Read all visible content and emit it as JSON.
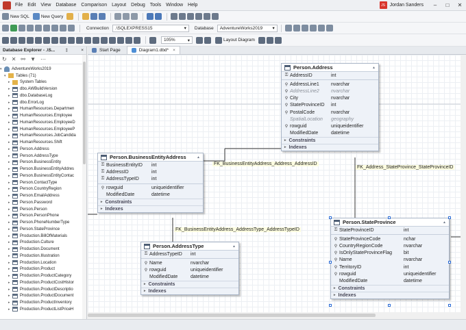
{
  "menu": {
    "items": [
      "File",
      "Edit",
      "View",
      "Database",
      "Comparison",
      "Layout",
      "Debug",
      "Tools",
      "Window",
      "Help"
    ],
    "user": "Jordan Sanders",
    "avatar": "JS"
  },
  "toolbar1": {
    "new_sql": "New SQL",
    "new_query": "New Query"
  },
  "toolbar2": {
    "connection_label": "Connection",
    "connection_value": ".\\SQLEXPRESS15",
    "database_label": "Database",
    "database_value": "AdventureWorks2019"
  },
  "toolbar3": {
    "zoom": "105%",
    "layout_diagram": "Layout Diagram"
  },
  "explorer": {
    "title": "Database Explorer - .\\S...",
    "pin": "‡",
    "close": "×",
    "db": "AdventureWorks2019",
    "tables": "Tables (71)",
    "items": [
      "System Tables",
      "dbo.AWBuildVersion",
      "dbo.DatabaseLog",
      "dbo.ErrorLog",
      "HumanResources.Departmen",
      "HumanResources.Employee",
      "HumanResources.EmployeeD",
      "HumanResources.EmployeeP",
      "HumanResources.JobCandida",
      "HumanResources.Shift",
      "Person.Address",
      "Person.AddressType",
      "Person.BusinessEntity",
      "Person.BusinessEntityAddres",
      "Person.BusinessEntityContac",
      "Person.ContactType",
      "Person.CountryRegion",
      "Person.EmailAddress",
      "Person.Password",
      "Person.Person",
      "Person.PersonPhone",
      "Person.PhoneNumberType",
      "Person.StateProvince",
      "Production.BillOfMaterials",
      "Production.Culture",
      "Production.Document",
      "Production.Illustration",
      "Production.Location",
      "Production.Product",
      "Production.ProductCategory",
      "Production.ProductCostHistor",
      "Production.ProductDescriptio",
      "Production.ProductDocument",
      "Production.ProductInventory",
      "Production.ProductListPriceH"
    ]
  },
  "tabs": [
    "Start Page",
    "Diagram1.dbd*"
  ],
  "tab_close": "×",
  "sections": {
    "constraints": "Constraints",
    "indexes": "Indexes"
  },
  "entities": {
    "address": {
      "title": "Person.Address",
      "cols": [
        [
          "AddressID",
          "int"
        ],
        [
          "AddressLine1",
          "nvarchar"
        ],
        [
          "AddressLine2",
          "nvarchar"
        ],
        [
          "City",
          "nvarchar"
        ],
        [
          "StateProvinceID",
          "int"
        ],
        [
          "PostalCode",
          "nvarchar"
        ],
        [
          "SpatialLocation",
          "geography"
        ],
        [
          "rowguid",
          "uniqueidentifier"
        ],
        [
          "ModifiedDate",
          "datetime"
        ]
      ]
    },
    "bea": {
      "title": "Person.BusinessEntityAddress",
      "cols": [
        [
          "BusinessEntityID",
          "int"
        ],
        [
          "AddressID",
          "int"
        ],
        [
          "AddressTypeID",
          "int"
        ],
        [
          "rowguid",
          "uniqueidentifier"
        ],
        [
          "ModifiedDate",
          "datetime"
        ]
      ]
    },
    "at": {
      "title": "Person.AddressType",
      "cols": [
        [
          "AddressTypeID",
          "int"
        ],
        [
          "Name",
          "nvarchar"
        ],
        [
          "rowguid",
          "uniqueidentifier"
        ],
        [
          "ModifiedDate",
          "datetime"
        ]
      ]
    },
    "sp": {
      "title": "Person.StateProvince",
      "cols": [
        [
          "StateProvinceID",
          "int"
        ],
        [
          "StateProvinceCode",
          "nchar"
        ],
        [
          "CountryRegionCode",
          "nvarchar"
        ],
        [
          "IsOnlyStateProvinceFlag",
          "bit"
        ],
        [
          "Name",
          "nvarchar"
        ],
        [
          "TerritoryID",
          "int"
        ],
        [
          "rowguid",
          "uniqueidentifier"
        ],
        [
          "ModifiedDate",
          "datetime"
        ]
      ]
    }
  },
  "relations": [
    "FK_BusinessEntityAddress_Address_AddressID",
    "FK_Address_StateProvince_StateProvinceID",
    "FK_BusinessEntityAddress_AddressType_AddressTypeID"
  ],
  "colors": {
    "accent": "#2a6bd6",
    "relation_label_bg": "#fdfde0",
    "user_badge": "#d9342b"
  }
}
